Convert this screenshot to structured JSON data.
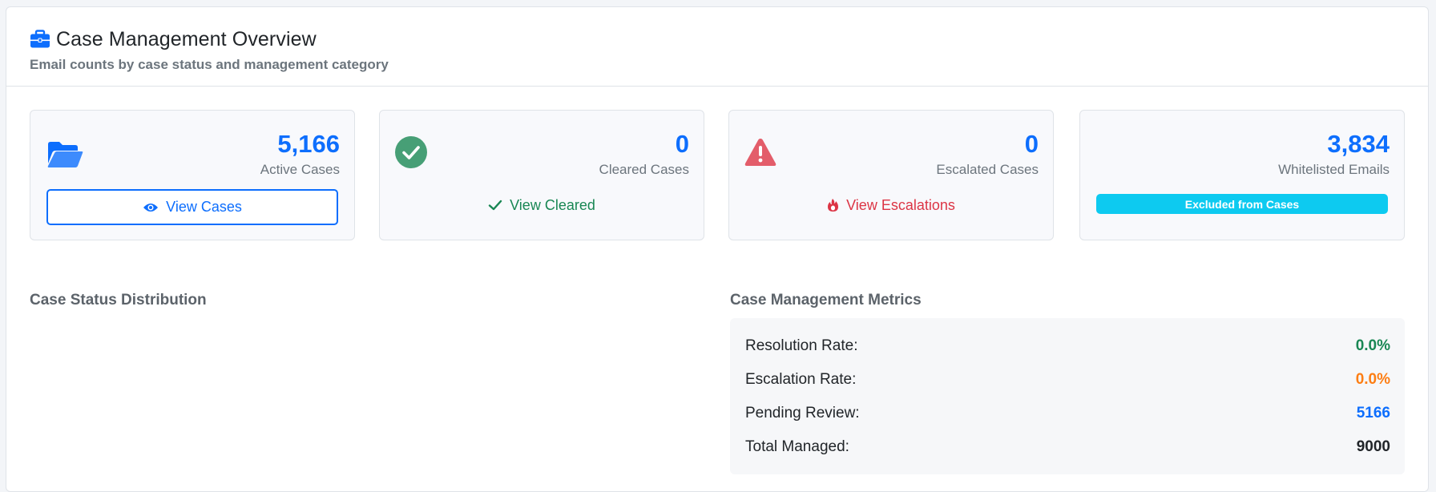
{
  "header": {
    "title": "Case Management Overview",
    "subtitle": "Email counts by case status and management category",
    "icon": "briefcase-icon"
  },
  "stats": [
    {
      "value": "5,166",
      "label": "Active Cases",
      "action": "View Cases",
      "icon": "folder-open-icon",
      "action_icon": "eye-icon",
      "color": "#0d6efd"
    },
    {
      "value": "0",
      "label": "Cleared Cases",
      "action": "View Cleared",
      "icon": "check-circle-icon",
      "action_icon": "check-icon",
      "color": "#198754"
    },
    {
      "value": "0",
      "label": "Escalated Cases",
      "action": "View Escalations",
      "icon": "warning-triangle-icon",
      "action_icon": "fire-icon",
      "color": "#dc3545"
    },
    {
      "value": "3,834",
      "label": "Whitelisted Emails",
      "badge": "Excluded from Cases",
      "color": "#0dcaf0"
    }
  ],
  "distribution": {
    "title": "Case Status Distribution"
  },
  "metrics": {
    "title": "Case Management Metrics",
    "rows": [
      {
        "label": "Resolution Rate:",
        "value": "0.0%",
        "color": "#198754"
      },
      {
        "label": "Escalation Rate:",
        "value": "0.0%",
        "color": "#fd7e14"
      },
      {
        "label": "Pending Review:",
        "value": "5166",
        "color": "#0d6efd"
      },
      {
        "label": "Total Managed:",
        "value": "9000",
        "color": "#212529"
      }
    ]
  }
}
